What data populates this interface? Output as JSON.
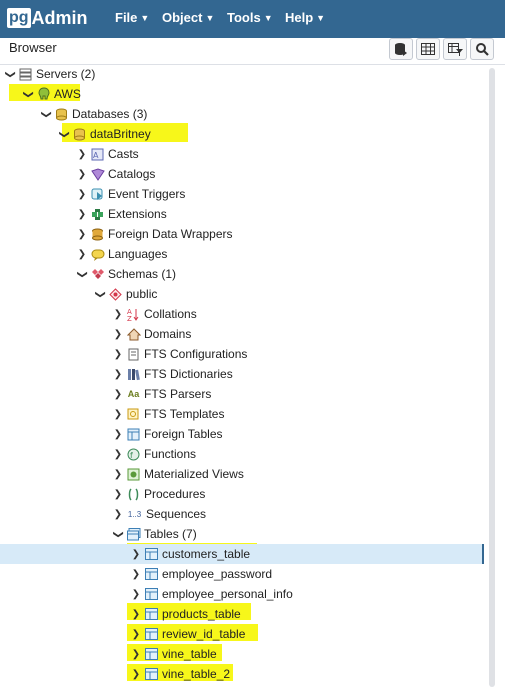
{
  "app": {
    "logo_pg": "pg",
    "logo_rest": "Admin"
  },
  "menu": {
    "file": "File",
    "object": "Object",
    "tools": "Tools",
    "help": "Help"
  },
  "browser": {
    "title": "Browser"
  },
  "colors": {
    "topbar": "#336791",
    "highlight": "#f7f71a",
    "selected_row": "#d7eaf8"
  },
  "tree": [
    {
      "label": "Servers (2)",
      "icon": "servers-icon"
    },
    {
      "label": "AWS",
      "icon": "server-elephant-icon"
    },
    {
      "label": "Databases (3)",
      "icon": "databases-icon"
    },
    {
      "label": "dataBritney",
      "icon": "database-icon"
    },
    {
      "label": "Casts",
      "icon": "casts-icon"
    },
    {
      "label": "Catalogs",
      "icon": "catalogs-icon"
    },
    {
      "label": "Event Triggers",
      "icon": "event-triggers-icon"
    },
    {
      "label": "Extensions",
      "icon": "extensions-icon"
    },
    {
      "label": "Foreign Data Wrappers",
      "icon": "foreign-data-wrappers-icon"
    },
    {
      "label": "Languages",
      "icon": "languages-icon"
    },
    {
      "label": "Schemas (1)",
      "icon": "schemas-icon"
    },
    {
      "label": "public",
      "icon": "schema-icon"
    },
    {
      "label": "Collations",
      "icon": "collations-icon"
    },
    {
      "label": "Domains",
      "icon": "domains-icon"
    },
    {
      "label": "FTS Configurations",
      "icon": "fts-configurations-icon"
    },
    {
      "label": "FTS Dictionaries",
      "icon": "fts-dictionaries-icon"
    },
    {
      "label": "FTS Parsers",
      "icon": "fts-parsers-icon",
      "icon_text": "Aa"
    },
    {
      "label": "FTS Templates",
      "icon": "fts-templates-icon"
    },
    {
      "label": "Foreign Tables",
      "icon": "foreign-tables-icon"
    },
    {
      "label": "Functions",
      "icon": "functions-icon"
    },
    {
      "label": "Materialized Views",
      "icon": "materialized-views-icon"
    },
    {
      "label": "Procedures",
      "icon": "procedures-icon"
    },
    {
      "label": "Sequences",
      "icon": "sequences-icon",
      "icon_text": "1..3"
    },
    {
      "label": "Tables (7)",
      "icon": "tables-icon"
    },
    {
      "label": "customers_table",
      "icon": "table-icon"
    },
    {
      "label": "employee_password",
      "icon": "table-icon"
    },
    {
      "label": "employee_personal_info",
      "icon": "table-icon"
    },
    {
      "label": "products_table",
      "icon": "table-icon"
    },
    {
      "label": "review_id_table",
      "icon": "table-icon"
    },
    {
      "label": "vine_table",
      "icon": "table-icon"
    },
    {
      "label": "vine_table_2",
      "icon": "table-icon"
    }
  ]
}
